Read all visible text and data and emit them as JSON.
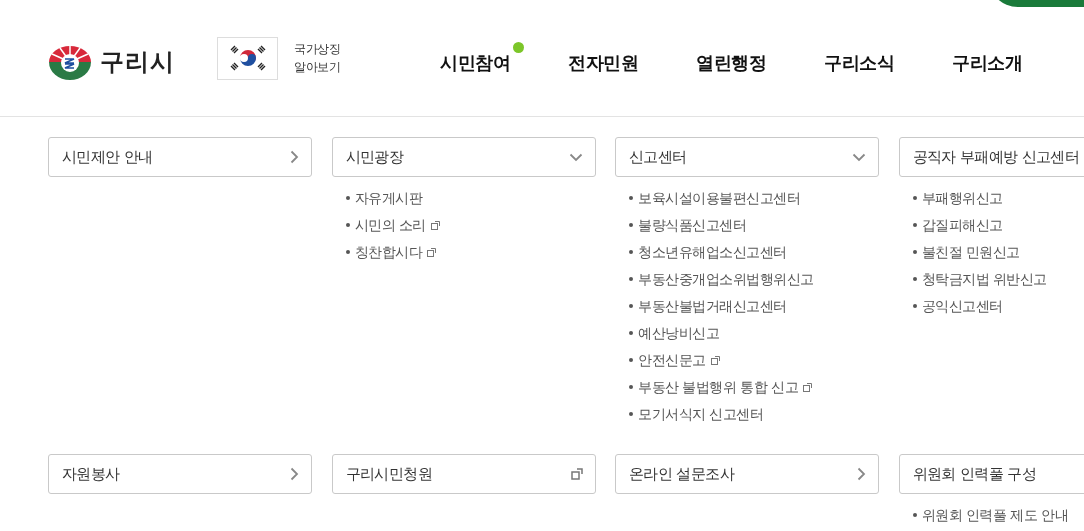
{
  "header": {
    "logo_text": "구리시",
    "symbol_link": {
      "line1": "국가상징",
      "line2": "알아보기"
    },
    "nav": [
      {
        "label": "시민참여",
        "dot": true
      },
      {
        "label": "전자민원",
        "dot": false
      },
      {
        "label": "열린행정",
        "dot": false
      },
      {
        "label": "구리소식",
        "dot": false
      },
      {
        "label": "구리소개",
        "dot": false
      }
    ]
  },
  "menu_rows": [
    [
      {
        "title": "시민제안 안내",
        "kind": "link"
      },
      {
        "title": "시민광장",
        "kind": "dropdown",
        "items": [
          {
            "label": "자유게시판",
            "external": false
          },
          {
            "label": "시민의 소리",
            "external": true
          },
          {
            "label": "칭찬합시다",
            "external": true
          }
        ]
      },
      {
        "title": "신고센터",
        "kind": "dropdown",
        "items": [
          {
            "label": "보육시설이용불편신고센터",
            "external": false
          },
          {
            "label": "불량식품신고센터",
            "external": false
          },
          {
            "label": "청소년유해업소신고센터",
            "external": false
          },
          {
            "label": "부동산중개업소위법행위신고",
            "external": false
          },
          {
            "label": "부동산불법거래신고센터",
            "external": false
          },
          {
            "label": "예산낭비신고",
            "external": false
          },
          {
            "label": "안전신문고",
            "external": true
          },
          {
            "label": "부동산 불법행위 통합 신고",
            "external": true
          },
          {
            "label": "모기서식지 신고센터",
            "external": false
          }
        ]
      },
      {
        "title": "공직자 부패예방 신고센터",
        "kind": "cut",
        "items": [
          {
            "label": "부패행위신고",
            "external": false
          },
          {
            "label": "갑질피해신고",
            "external": false
          },
          {
            "label": "불친절 민원신고",
            "external": false
          },
          {
            "label": "청탁금지법 위반신고",
            "external": false
          },
          {
            "label": "공익신고센터",
            "external": false
          }
        ]
      }
    ],
    [
      {
        "title": "자원봉사",
        "kind": "link"
      },
      {
        "title": "구리시민청원",
        "kind": "external"
      },
      {
        "title": "온라인 설문조사",
        "kind": "link"
      },
      {
        "title": "위원회 인력풀 구성",
        "kind": "cut",
        "items": [
          {
            "label": "위원회 인력풀 제도 안내",
            "external": false
          }
        ]
      }
    ]
  ]
}
